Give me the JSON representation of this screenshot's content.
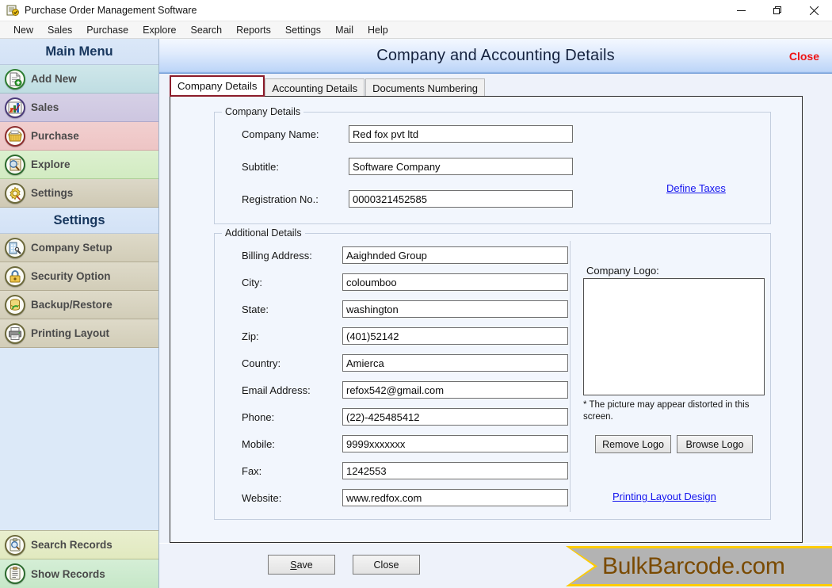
{
  "window": {
    "title": "Purchase Order Management Software",
    "app_icon": "app-icon",
    "controls": {
      "minimize": "—",
      "restore": "❐",
      "close": "✕"
    }
  },
  "menubar": {
    "items": [
      "New",
      "Sales",
      "Purchase",
      "Explore",
      "Search",
      "Reports",
      "Settings",
      "Mail",
      "Help"
    ]
  },
  "sidebar": {
    "main_header": "Main Menu",
    "main_items": [
      {
        "label": "Add New",
        "icon": "document-add-icon"
      },
      {
        "label": "Sales",
        "icon": "bar-chart-icon"
      },
      {
        "label": "Purchase",
        "icon": "basket-icon"
      },
      {
        "label": "Explore",
        "icon": "magnifier-document-icon"
      },
      {
        "label": "Settings",
        "icon": "gear-pencil-icon"
      }
    ],
    "settings_header": "Settings",
    "settings_items": [
      {
        "label": "Company Setup",
        "icon": "building-wrench-icon"
      },
      {
        "label": "Security Option",
        "icon": "padlock-icon"
      },
      {
        "label": "Backup/Restore",
        "icon": "database-refresh-icon"
      },
      {
        "label": "Printing Layout",
        "icon": "printer-icon"
      }
    ],
    "bottom_items": [
      {
        "label": "Search Records",
        "icon": "clipboard-magnifier-icon"
      },
      {
        "label": "Show Records",
        "icon": "clipboard-list-icon"
      }
    ]
  },
  "form": {
    "title": "Company and Accounting Details",
    "close_label": "Close",
    "tabs": [
      {
        "label": "Company Details",
        "active": true
      },
      {
        "label": "Accounting Details",
        "active": false
      },
      {
        "label": "Documents Numbering",
        "active": false
      }
    ],
    "company_details": {
      "legend": "Company Details",
      "fields": [
        {
          "label": "Company Name:",
          "value": "Red fox pvt ltd"
        },
        {
          "label": "Subtitle:",
          "value": "Software Company"
        },
        {
          "label": "Registration No.:",
          "value": "0000321452585"
        }
      ],
      "define_taxes_link": "Define Taxes"
    },
    "additional_details": {
      "legend": "Additional Details",
      "fields": [
        {
          "label": "Billing Address:",
          "value": "Aaighnded Group"
        },
        {
          "label": "City:",
          "value": "coloumboo"
        },
        {
          "label": "State:",
          "value": "washington"
        },
        {
          "label": "Zip:",
          "value": "(401)52142"
        },
        {
          "label": "Country:",
          "value": "Amierca"
        },
        {
          "label": "Email Address:",
          "value": "refox542@gmail.com"
        },
        {
          "label": "Phone:",
          "value": "(22)-425485412"
        },
        {
          "label": "Mobile:",
          "value": "9999xxxxxxx"
        },
        {
          "label": "Fax:",
          "value": "1242553"
        },
        {
          "label": "Website:",
          "value": "www.redfox.com"
        }
      ],
      "logo_label": "Company Logo:",
      "logo_note": "* The picture may appear distorted in this screen.",
      "remove_logo_label": "Remove Logo",
      "browse_logo_label": "Browse Logo",
      "printing_layout_link": "Printing Layout Design"
    },
    "footer": {
      "save_label": "Save",
      "save_accel": "S",
      "close_label": "Close"
    }
  },
  "brand": {
    "text": "BulkBarcode.com"
  },
  "colors": {
    "accent_blue": "#7fa9e0",
    "close_red": "#ef1414",
    "active_tab_border": "#8c1c2a",
    "link_blue": "#1414ee",
    "brand_yellow": "#ffcc00",
    "brand_gray": "#b3b3b3",
    "brand_text": "#7a4a00"
  }
}
